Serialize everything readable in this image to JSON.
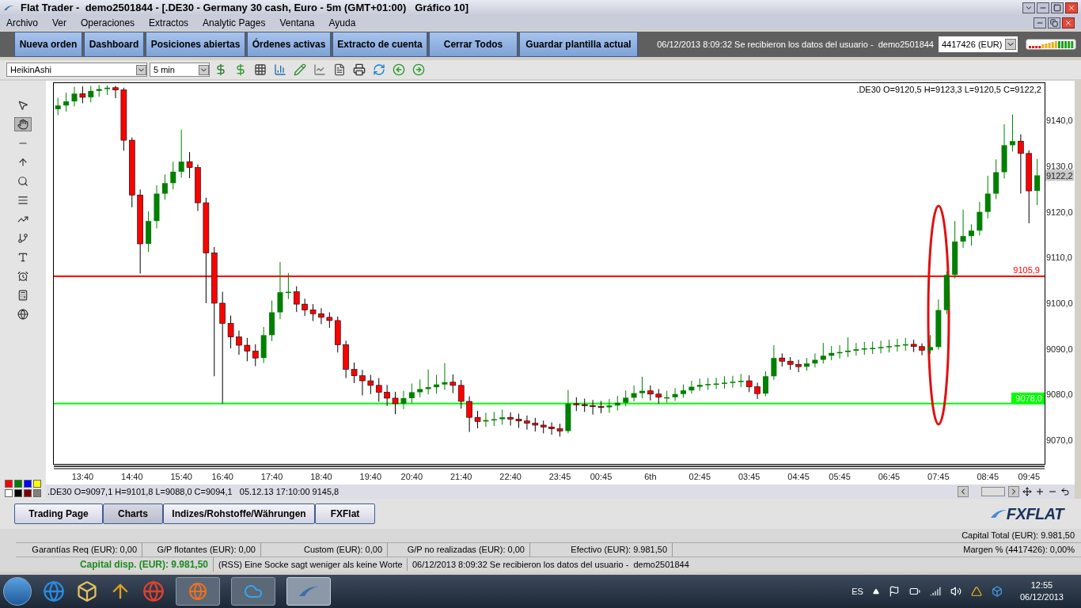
{
  "window": {
    "title": "Flat Trader -  demo2501844 - [.DE30 - Germany 30 cash, Euro - 5m (GMT+01:00)   Gráfico 10]"
  },
  "menu": [
    "Archivo",
    "Ver",
    "Operaciones",
    "Extractos",
    "Analytic Pages",
    "Ventana",
    "Ayuda"
  ],
  "nav_buttons": [
    "Nueva orden",
    "Dashboard",
    "Posiciones abiertas",
    "Órdenes activas",
    "Extracto de cuenta",
    "Cerrar Todos",
    "Guardar plantilla actual"
  ],
  "status_message": "06/12/2013 8:09:32 Se recibieron los datos del usuario -  demo2501844",
  "account_select": {
    "value": "4417426 (EUR)"
  },
  "chart_toolbar": {
    "chart_type": "HeikinAshi",
    "interval": "5 min"
  },
  "left_tools": [
    {
      "selected": false
    },
    {
      "selected": true
    },
    {
      "selected": false
    },
    {
      "selected": false
    },
    {
      "selected": false
    },
    {
      "selected": false
    },
    {
      "selected": false
    },
    {
      "selected": false
    },
    {
      "selected": false
    },
    {
      "selected": false
    },
    {
      "selected": false
    },
    {
      "selected": false
    }
  ],
  "palette": [
    {
      "color": "#ff0000"
    },
    {
      "color": "#008000"
    },
    {
      "color": "#0000ff"
    },
    {
      "color": "#ffff00"
    },
    {
      "color": "#ffffff"
    },
    {
      "color": "#000000"
    },
    {
      "color": "#800000"
    },
    {
      "color": "#808080"
    }
  ],
  "chart": {
    "ohlc_header": ".DE30 O=9120,5 H=9123,3 L=9120,5 C=9122,2",
    "current_price": "9122,2",
    "info": ".DE30 O=9097,1 H=9101,8 L=9088,0 C=9094,1   05.12.13 17:10:00 9145,8",
    "chart_data": {
      "type": "candlestick",
      "categories": [
        null,
        null,
        null,
        "13:40",
        null,
        null,
        null,
        null,
        null,
        "14:40",
        null,
        null,
        null,
        null,
        null,
        "15:40",
        null,
        null,
        null,
        null,
        "16:40",
        null,
        null,
        null,
        null,
        null,
        "17:40",
        null,
        null,
        null,
        null,
        null,
        "18:40",
        null,
        null,
        null,
        null,
        null,
        "19:40",
        null,
        null,
        null,
        null,
        "20:40",
        null,
        null,
        null,
        null,
        null,
        "21:40",
        null,
        null,
        null,
        null,
        null,
        "22:40",
        null,
        null,
        null,
        null,
        null,
        "23:45",
        null,
        null,
        null,
        null,
        "00:45",
        null,
        null,
        null,
        null,
        null,
        "6th",
        null,
        null,
        null,
        null,
        null,
        "02:45",
        null,
        null,
        null,
        null,
        null,
        "03:45",
        null,
        null,
        null,
        null,
        null,
        "04:45",
        null,
        null,
        null,
        null,
        "05:45",
        null,
        null,
        null,
        null,
        null,
        "06:45",
        null,
        null,
        null,
        null,
        null,
        "07:45",
        null,
        null,
        null,
        null,
        null,
        "08:45",
        null,
        null,
        null,
        null,
        "09:45",
        null
      ],
      "ylim": [
        9064.8,
        9148.2
      ],
      "yticks": [
        {
          "value": 9140,
          "label": "9140,0"
        },
        {
          "value": 9130,
          "label": "9130,0"
        },
        {
          "value": 9120,
          "label": "9120,0"
        },
        {
          "value": 9110,
          "label": "9110,0"
        },
        {
          "value": 9100,
          "label": "9100,0"
        },
        {
          "value": 9090,
          "label": "9090,0"
        },
        {
          "value": 9080,
          "label": "9080,0"
        },
        {
          "value": 9070,
          "label": "9070,0"
        }
      ],
      "ref_lines": [
        {
          "axis": "y",
          "value": 9105.9,
          "label": "9105,9",
          "color": "#ff0000"
        },
        {
          "axis": "y",
          "value": 9078.0,
          "label": "9078,0",
          "color": "#00ff00"
        }
      ],
      "ohlc": [
        [
          9142.5,
          9145.0,
          9141.2,
          9143.3
        ],
        [
          9143.3,
          9146.1,
          9142.0,
          9144.2
        ],
        [
          9144.2,
          9147.4,
          9143.1,
          9145.9
        ],
        [
          9145.9,
          9147.5,
          9143.8,
          9145.1
        ],
        [
          9145.1,
          9147.6,
          9144.0,
          9146.5
        ],
        [
          9146.5,
          9147.8,
          9145.2,
          9146.9
        ],
        [
          9146.9,
          9147.7,
          9145.6,
          9147.2
        ],
        [
          9147.2,
          9147.6,
          9144.9,
          9146.7
        ],
        [
          9146.7,
          9147.2,
          9133.4,
          9135.7
        ],
        [
          9135.7,
          9136.3,
          9121.0,
          9123.7
        ],
        [
          9123.7,
          9124.9,
          9106.5,
          9113.0
        ],
        [
          9113.0,
          9120.1,
          9111.2,
          9118.0
        ],
        [
          9118.0,
          9125.8,
          9116.4,
          9124.0
        ],
        [
          9124.0,
          9128.2,
          9122.7,
          9126.3
        ],
        [
          9126.3,
          9131.0,
          9124.9,
          9128.8
        ],
        [
          9128.8,
          9138.0,
          9127.5,
          9131.0
        ],
        [
          9131.0,
          9133.1,
          9127.4,
          9129.7
        ],
        [
          9129.7,
          9130.4,
          9120.2,
          9122.0
        ],
        [
          9122.0,
          9123.1,
          9100.0,
          9111.0
        ],
        [
          9111.0,
          9112.3,
          9084.0,
          9100.0
        ],
        [
          9100.0,
          9102.5,
          9078.0,
          9095.6
        ],
        [
          9095.6,
          9097.3,
          9090.1,
          9092.6
        ],
        [
          9092.6,
          9094.0,
          9088.7,
          9090.8
        ],
        [
          9090.8,
          9092.4,
          9087.3,
          9089.5
        ],
        [
          9089.5,
          9091.0,
          9086.2,
          9088.0
        ],
        [
          9088.0,
          9094.8,
          9086.9,
          9093.0
        ],
        [
          9093.0,
          9100.6,
          9091.7,
          9098.0
        ],
        [
          9098.0,
          9109.0,
          9096.5,
          9102.4
        ],
        [
          9102.4,
          9106.6,
          9100.9,
          9102.5
        ],
        [
          9102.5,
          9103.7,
          9098.1,
          9099.8
        ],
        [
          9099.8,
          9101.0,
          9097.2,
          9098.5
        ],
        [
          9098.5,
          9099.8,
          9096.1,
          9097.7
        ],
        [
          9097.7,
          9098.9,
          9095.4,
          9096.9
        ],
        [
          9096.9,
          9098.0,
          9094.6,
          9096.2
        ],
        [
          9096.2,
          9097.1,
          9089.2,
          9090.9
        ],
        [
          9090.9,
          9091.8,
          9083.6,
          9085.5
        ],
        [
          9085.5,
          9087.0,
          9082.5,
          9084.1
        ],
        [
          9084.1,
          9085.4,
          9079.8,
          9083.0
        ],
        [
          9083.0,
          9084.3,
          9080.1,
          9082.0
        ],
        [
          9082.0,
          9083.6,
          9078.4,
          9080.5
        ],
        [
          9080.5,
          9082.1,
          9077.5,
          9079.2
        ],
        [
          9079.2,
          9080.6,
          9075.7,
          9078.0
        ],
        [
          9078.0,
          9080.8,
          9076.8,
          9079.2
        ],
        [
          9079.2,
          9082.4,
          9078.1,
          9080.5
        ],
        [
          9080.5,
          9083.3,
          9079.4,
          9081.2
        ],
        [
          9081.2,
          9085.5,
          9080.0,
          9081.6
        ],
        [
          9081.6,
          9084.3,
          9080.2,
          9082.2
        ],
        [
          9082.2,
          9086.9,
          9081.0,
          9082.7
        ],
        [
          9082.7,
          9084.4,
          9080.3,
          9082.0
        ],
        [
          9082.0,
          9083.2,
          9076.9,
          9078.5
        ],
        [
          9078.5,
          9079.6,
          9071.8,
          9075.0
        ],
        [
          9075.0,
          9076.4,
          9072.6,
          9074.1
        ],
        [
          9074.1,
          9076.0,
          9072.9,
          9074.4
        ],
        [
          9074.4,
          9076.2,
          9073.1,
          9074.6
        ],
        [
          9074.6,
          9076.7,
          9073.4,
          9075.0
        ],
        [
          9075.0,
          9076.1,
          9073.2,
          9074.6
        ],
        [
          9074.6,
          9075.8,
          9072.7,
          9074.2
        ],
        [
          9074.2,
          9075.4,
          9072.3,
          9073.7
        ],
        [
          9073.7,
          9074.9,
          9071.9,
          9073.3
        ],
        [
          9073.3,
          9074.3,
          9071.5,
          9072.9
        ],
        [
          9072.9,
          9073.9,
          9071.2,
          9072.5
        ],
        [
          9072.5,
          9073.6,
          9070.8,
          9072.0
        ],
        [
          9072.0,
          9081.0,
          9071.5,
          9078.0
        ],
        [
          9078.0,
          9079.4,
          9076.4,
          9077.8
        ],
        [
          9077.8,
          9079.1,
          9076.2,
          9077.6
        ],
        [
          9077.6,
          9078.8,
          9075.6,
          9077.4
        ],
        [
          9077.4,
          9078.6,
          9075.9,
          9077.2
        ],
        [
          9077.2,
          9079.0,
          9076.0,
          9077.6
        ],
        [
          9077.6,
          9079.7,
          9076.5,
          9078.2
        ],
        [
          9078.2,
          9080.9,
          9077.4,
          9079.3
        ],
        [
          9079.3,
          9082.0,
          9078.5,
          9080.3
        ],
        [
          9080.3,
          9083.9,
          9079.2,
          9080.8
        ],
        [
          9080.8,
          9082.0,
          9078.7,
          9080.1
        ],
        [
          9080.1,
          9081.2,
          9078.0,
          9079.4
        ],
        [
          9079.4,
          9080.8,
          9078.2,
          9079.4
        ],
        [
          9079.4,
          9081.4,
          9078.6,
          9080.1
        ],
        [
          9080.1,
          9082.2,
          9079.3,
          9080.9
        ],
        [
          9080.9,
          9083.0,
          9080.2,
          9081.7
        ],
        [
          9081.7,
          9083.5,
          9080.8,
          9082.1
        ],
        [
          9082.1,
          9083.6,
          9081.0,
          9082.3
        ],
        [
          9082.3,
          9083.7,
          9081.2,
          9082.4
        ],
        [
          9082.4,
          9084.0,
          9081.3,
          9082.6
        ],
        [
          9082.6,
          9084.1,
          9081.5,
          9082.8
        ],
        [
          9082.8,
          9084.5,
          9081.6,
          9083.0
        ],
        [
          9083.0,
          9084.2,
          9080.5,
          9081.7
        ],
        [
          9081.7,
          9082.6,
          9079.0,
          9080.2
        ],
        [
          9080.2,
          9085.1,
          9079.6,
          9084.0
        ],
        [
          9084.0,
          9090.8,
          9083.2,
          9088.0
        ],
        [
          9088.0,
          9089.0,
          9086.1,
          9087.3
        ],
        [
          9087.3,
          9088.2,
          9085.4,
          9086.6
        ],
        [
          9086.6,
          9087.6,
          9084.9,
          9086.1
        ],
        [
          9086.1,
          9088.0,
          9085.2,
          9086.8
        ],
        [
          9086.8,
          9089.0,
          9085.9,
          9087.6
        ],
        [
          9087.6,
          9091.3,
          9086.8,
          9088.5
        ],
        [
          9088.5,
          9090.6,
          9087.5,
          9089.1
        ],
        [
          9089.1,
          9090.8,
          9087.9,
          9089.3
        ],
        [
          9089.3,
          9092.5,
          9088.2,
          9089.6
        ],
        [
          9089.6,
          9091.3,
          9088.5,
          9089.9
        ],
        [
          9089.9,
          9091.5,
          9088.7,
          9090.1
        ],
        [
          9090.1,
          9091.6,
          9088.9,
          9090.2
        ],
        [
          9090.2,
          9091.8,
          9089.0,
          9090.4
        ],
        [
          9090.4,
          9092.0,
          9089.2,
          9090.6
        ],
        [
          9090.6,
          9092.2,
          9089.4,
          9090.8
        ],
        [
          9090.8,
          9092.4,
          9089.6,
          9091.0
        ],
        [
          9091.0,
          9092.0,
          9089.3,
          9090.5
        ],
        [
          9090.5,
          9091.2,
          9088.6,
          9089.7
        ],
        [
          9089.7,
          9093.0,
          9088.9,
          9090.4
        ],
        [
          9090.4,
          9100.8,
          9089.8,
          9098.5
        ],
        [
          9098.5,
          9107.0,
          9097.6,
          9106.2
        ],
        [
          9106.2,
          9118.0,
          9105.4,
          9113.5
        ],
        [
          9113.5,
          9120.5,
          9112.1,
          9114.7
        ],
        [
          9114.7,
          9117.3,
          9112.6,
          9115.9
        ],
        [
          9115.9,
          9122.2,
          9114.8,
          9120.0
        ],
        [
          9120.0,
          9127.9,
          9118.6,
          9124.0
        ],
        [
          9124.0,
          9131.5,
          9122.8,
          9128.7
        ],
        [
          9128.7,
          9139.2,
          9127.3,
          9134.6
        ],
        [
          9134.6,
          9141.3,
          9133.2,
          9135.5
        ],
        [
          9135.5,
          9137.0,
          9124.0,
          9132.8
        ],
        [
          9132.8,
          9133.5,
          9117.5,
          9124.6
        ],
        [
          9124.6,
          9131.6,
          9121.5,
          9128.0
        ]
      ]
    }
  },
  "bottom_tabs": [
    {
      "label": "Trading Page",
      "selected": false
    },
    {
      "label": "Charts",
      "selected": true
    },
    {
      "label": "Indizes/Rohstoffe/Währungen",
      "selected": false
    },
    {
      "label": "FXFlat",
      "selected": false
    }
  ],
  "logo": "FXFLAT",
  "status": {
    "capital_total": "Capital Total (EUR): 9.981,50",
    "row2": [
      "Garantías Req (EUR): 0,00",
      "G/P flotantes (EUR): 0,00",
      "Custom (EUR): 0,00",
      "G/P no realizadas (EUR): 0,00",
      "Efectivo (EUR): 9.981,50"
    ],
    "margin": "Margen % (4417426): 0,00%",
    "capital_disp": "Capital disp. (EUR): 9.981,50",
    "rss": "(RSS) Eine Socke sagt weniger als keine Worte",
    "message": "06/12/2013 8:09:32 Se recibieron los datos del usuario -  demo2501844"
  },
  "taskbar": {
    "language": "ES",
    "time": "12:55",
    "date": "06/12/2013"
  }
}
